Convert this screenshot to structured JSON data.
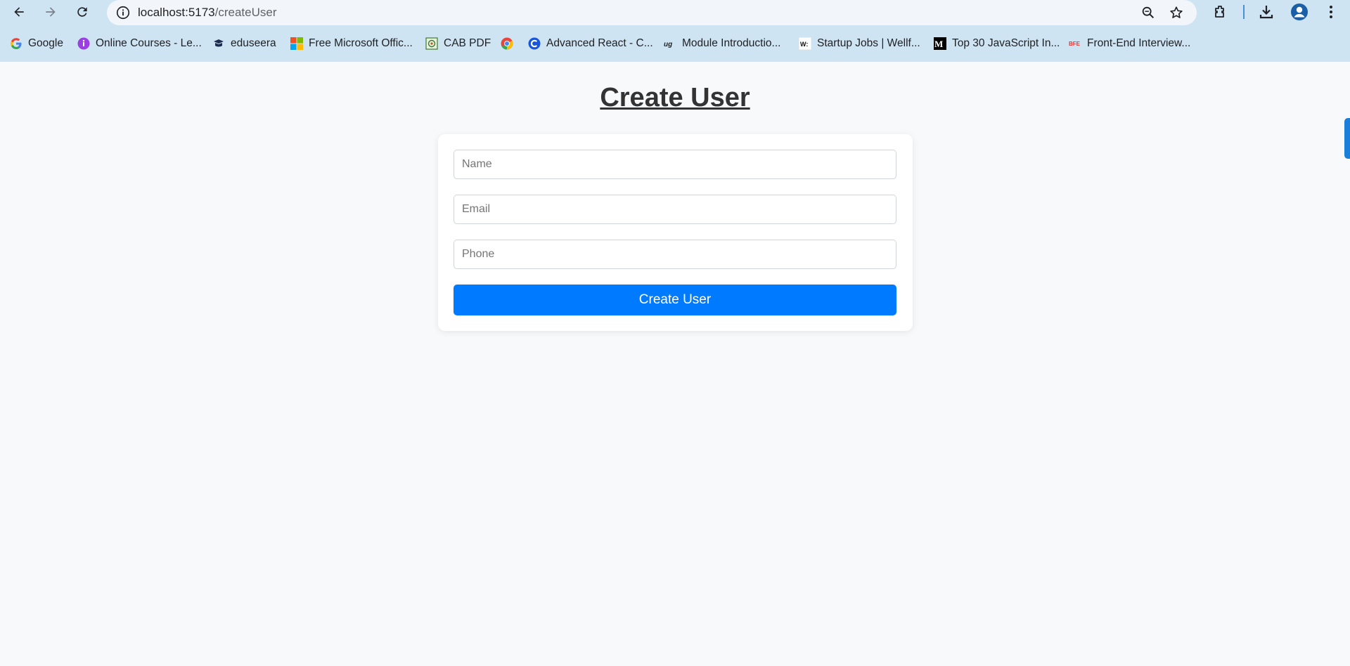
{
  "browser": {
    "url_host": "localhost:5173",
    "url_path": "/createUser",
    "bookmarks": [
      {
        "label": "Google",
        "icon": "google-icon"
      },
      {
        "label": "Online Courses - Le...",
        "icon": "online-courses-icon"
      },
      {
        "label": "eduseera",
        "icon": "eduseera-icon"
      },
      {
        "label": "Free Microsoft Offic...",
        "icon": "microsoft-icon"
      },
      {
        "label": "CAB PDF",
        "icon": "cab-pdf-icon"
      },
      {
        "label": "",
        "icon": "chrome-icon"
      },
      {
        "label": "Advanced React - C...",
        "icon": "advanced-react-icon"
      },
      {
        "label": "Module Introductio...",
        "icon": "module-icon"
      },
      {
        "label": "Startup Jobs | Wellf...",
        "icon": "wellfound-icon"
      },
      {
        "label": "Top 30 JavaScript In...",
        "icon": "medium-icon"
      },
      {
        "label": "Front-End Interview...",
        "icon": "bfe-icon"
      }
    ]
  },
  "page": {
    "title": "Create User"
  },
  "form": {
    "name_placeholder": "Name",
    "name_value": "",
    "email_placeholder": "Email",
    "email_value": "",
    "phone_placeholder": "Phone",
    "phone_value": "",
    "submit_label": "Create User"
  },
  "colors": {
    "accent": "#007bff",
    "browser_bar": "#cfe4f3",
    "background": "#f7f9fb"
  }
}
